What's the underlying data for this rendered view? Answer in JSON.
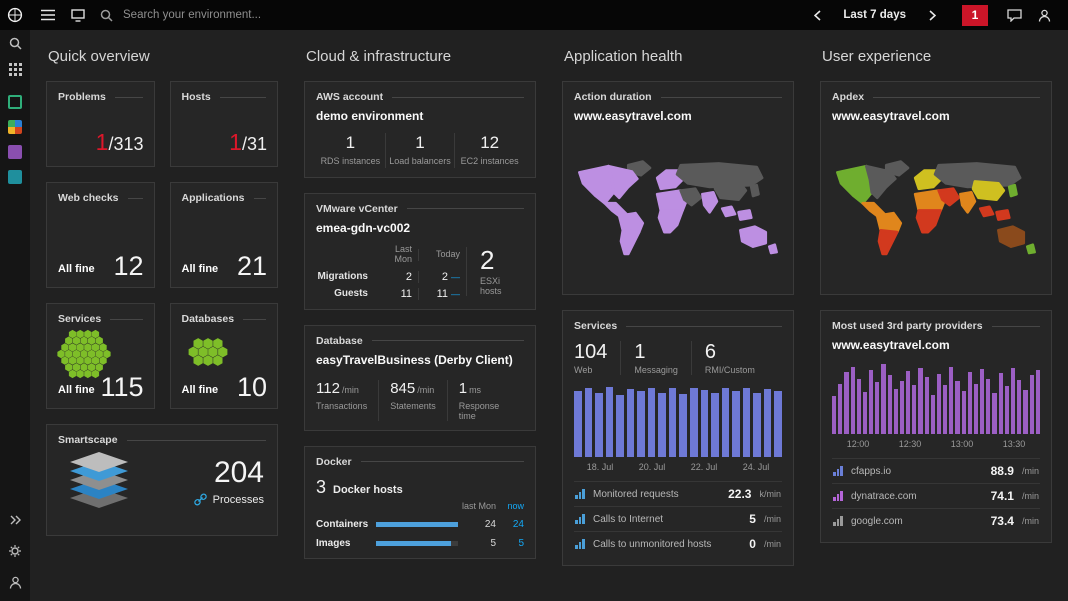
{
  "topbar": {
    "search_placeholder": "Search your environment...",
    "time_range_label": "Last 7 days",
    "problems_badge": "1"
  },
  "quick_overview": {
    "section_title": "Quick overview",
    "problems": {
      "title": "Problems",
      "value": "1",
      "total": "/313"
    },
    "hosts": {
      "title": "Hosts",
      "value": "1",
      "total": "/31"
    },
    "web_checks": {
      "title": "Web checks",
      "status": "All fine",
      "value": "12"
    },
    "applications": {
      "title": "Applications",
      "status": "All fine",
      "value": "21"
    },
    "services": {
      "title": "Services",
      "status": "All fine",
      "value": "115"
    },
    "databases": {
      "title": "Databases",
      "status": "All fine",
      "value": "10"
    },
    "smartscape": {
      "title": "Smartscape",
      "value": "204",
      "link_label": "Processes"
    }
  },
  "cloud_infrastructure": {
    "section_title": "Cloud & infrastructure",
    "aws": {
      "title": "AWS account",
      "subtitle": "demo environment",
      "stats": [
        {
          "value": "1",
          "label": "RDS instances"
        },
        {
          "value": "1",
          "label": "Load balancers"
        },
        {
          "value": "12",
          "label": "EC2 instances"
        }
      ]
    },
    "vmware": {
      "title": "VMware vCenter",
      "subtitle": "emea-gdn-vc002",
      "col_last_mon": "Last Mon",
      "col_today": "Today",
      "rows": [
        {
          "label": "Migrations",
          "last_mon": "2",
          "today": "2"
        },
        {
          "label": "Guests",
          "last_mon": "11",
          "today": "11"
        }
      ],
      "esxi_value": "2",
      "esxi_label": "ESXi hosts"
    },
    "database": {
      "title": "Database",
      "subtitle": "easyTravelBusiness (Derby Client)",
      "stats": [
        {
          "value": "112",
          "unit": "/min",
          "label": "Transactions"
        },
        {
          "value": "845",
          "unit": "/min",
          "label": "Statements"
        },
        {
          "value": "1",
          "unit": "ms",
          "label": "Response time"
        }
      ]
    },
    "docker": {
      "title": "Docker",
      "hosts_value": "3",
      "hosts_label": "Docker hosts",
      "col_last_mon": "last Mon",
      "col_now": "now",
      "rows": [
        {
          "label": "Containers",
          "last_mon": "24",
          "now": "24"
        },
        {
          "label": "Images",
          "last_mon": "5",
          "now": "5"
        }
      ]
    }
  },
  "application_health": {
    "section_title": "Application health",
    "action_duration": {
      "title": "Action duration",
      "subtitle": "www.easytravel.com"
    },
    "services": {
      "title": "Services",
      "stats": [
        {
          "value": "104",
          "label": "Web"
        },
        {
          "value": "1",
          "label": "Messaging"
        },
        {
          "value": "6",
          "label": "RMI/Custom"
        }
      ],
      "metrics": [
        {
          "label": "Monitored requests",
          "value": "22.3",
          "unit": "k/min",
          "icon_color": "#4a9fd8"
        },
        {
          "label": "Calls to Internet",
          "value": "5",
          "unit": "/min",
          "icon_color": "#4a9fd8"
        },
        {
          "label": "Calls to unmonitored hosts",
          "value": "0",
          "unit": "/min",
          "icon_color": "#4a9fd8"
        }
      ]
    }
  },
  "user_experience": {
    "section_title": "User experience",
    "apdex": {
      "title": "Apdex",
      "subtitle": "www.easytravel.com"
    },
    "providers": {
      "title": "Most used 3rd party providers",
      "subtitle": "www.easytravel.com",
      "metrics": [
        {
          "label": "cfapps.io",
          "value": "88.9",
          "unit": "/min",
          "icon_color": "#6a7fd8"
        },
        {
          "label": "dynatrace.com",
          "value": "74.1",
          "unit": "/min",
          "icon_color": "#b465d8"
        },
        {
          "label": "google.com",
          "value": "73.4",
          "unit": "/min",
          "icon_color": "#9a9a9a"
        }
      ]
    }
  },
  "chart_data": [
    {
      "id": "services_requests",
      "type": "bar",
      "title": "Service requests over time",
      "x_ticks": [
        "18. Jul",
        "20. Jul",
        "22. Jul",
        "24. Jul"
      ],
      "values": [
        92,
        96,
        90,
        98,
        86,
        95,
        93,
        97,
        89,
        96,
        88,
        97,
        94,
        90,
        96,
        92,
        97,
        90,
        95,
        93
      ],
      "color": "#6e79d6",
      "legend": "none",
      "grid": "off"
    },
    {
      "id": "third_party_providers",
      "type": "bar",
      "title": "3rd party provider calls over time",
      "x_ticks": [
        "12:00",
        "12:30",
        "13:00",
        "13:30"
      ],
      "values": [
        55,
        72,
        88,
        96,
        78,
        60,
        92,
        74,
        100,
        84,
        64,
        76,
        90,
        70,
        95,
        82,
        56,
        86,
        70,
        96,
        76,
        62,
        88,
        72,
        93,
        79,
        58,
        87,
        68,
        95,
        77,
        63,
        85,
        91
      ],
      "color": "#9c5fc4",
      "legend": "none",
      "grid": "off"
    },
    {
      "id": "docker_resources",
      "type": "bar",
      "orientation": "horizontal",
      "categories": [
        "Containers",
        "Images"
      ],
      "series": [
        {
          "name": "last Mon",
          "values": [
            24,
            5
          ]
        },
        {
          "name": "now",
          "values": [
            24,
            5
          ]
        }
      ]
    }
  ],
  "maps": {
    "action_duration": {
      "greenland": "#5a5a5a",
      "na_west": "#bd8fe2",
      "na_east": "#bd8fe2",
      "central_america": "#bd8fe2",
      "sa_north": "#bd8fe2",
      "sa_south": "#bd8fe2",
      "europe": "#bd8fe2",
      "africa_north": "#bd8fe2",
      "africa_south": "#bd8fe2",
      "russia": "#5a5a5a",
      "middle_east": "#5a5a5a",
      "india": "#bd8fe2",
      "china": "#5a5a5a",
      "japan": "#5a5a5a",
      "se_asia": "#bd8fe2",
      "australia": "#bd8fe2",
      "new_zealand": "#bd8fe2"
    },
    "apdex": {
      "greenland": "#5a5a5a",
      "na_west": "#6fae2f",
      "na_east": "#5a5a5a",
      "central_america": "#e0861c",
      "sa_north": "#e0861c",
      "sa_south": "#d2391e",
      "europe": "#cfc020",
      "africa_north": "#e0861c",
      "africa_south": "#d2391e",
      "russia": "#5a5a5a",
      "middle_east": "#d2391e",
      "india": "#e0861c",
      "china": "#cfc020",
      "japan": "#6fae2f",
      "se_asia": "#d2391e",
      "australia": "#8a4a1c",
      "new_zealand": "#6fae2f"
    }
  },
  "colors": {
    "accent_blue": "#14a8f5",
    "alert_red": "#dc172a",
    "health_green": "#7ebe28"
  }
}
